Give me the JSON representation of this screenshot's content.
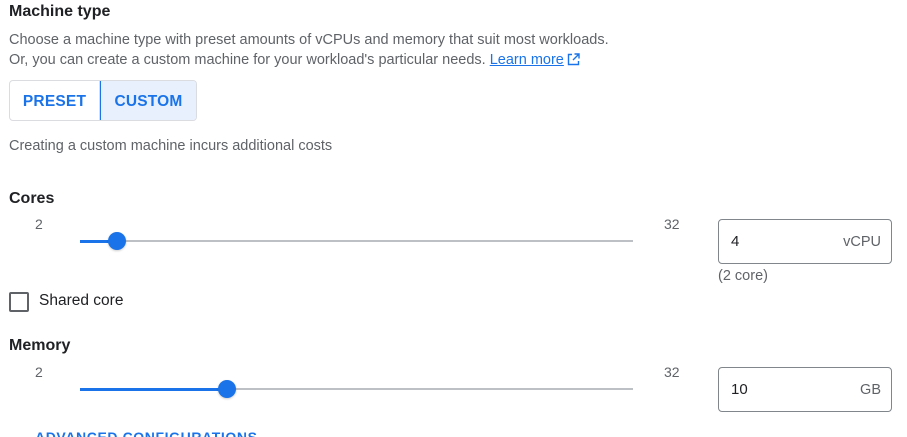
{
  "machine_type": {
    "title": "Machine type",
    "description_line1": "Choose a machine type with preset amounts of vCPUs and memory that suit most workloads.",
    "description_line2": "Or, you can create a custom machine for your workload's particular needs. ",
    "learn_more": "Learn more",
    "tabs": [
      {
        "label": "PRESET",
        "selected": false
      },
      {
        "label": "CUSTOM",
        "selected": true
      }
    ],
    "custom_note": "Creating a custom machine incurs additional costs"
  },
  "cores": {
    "label": "Cores",
    "min": 2,
    "max": 32,
    "min_label": "2",
    "max_label": "32",
    "value": 4,
    "input_value": "4",
    "unit": "vCPU",
    "hint": "(2 core)"
  },
  "shared_core": {
    "label": "Shared core",
    "checked": false
  },
  "memory": {
    "label": "Memory",
    "min": 2,
    "max": 32,
    "min_label": "2",
    "max_label": "32",
    "value": 10,
    "input_value": "10",
    "unit": "GB"
  },
  "advanced": {
    "label": "ADVANCED CONFIGURATIONS"
  },
  "colors": {
    "accent": "#1a73e8",
    "selected_bg": "#e8f0fe",
    "track": "#bdc1c6",
    "secondary_text": "#5f6368"
  },
  "icons": {
    "learn_more": "external-link-icon"
  }
}
